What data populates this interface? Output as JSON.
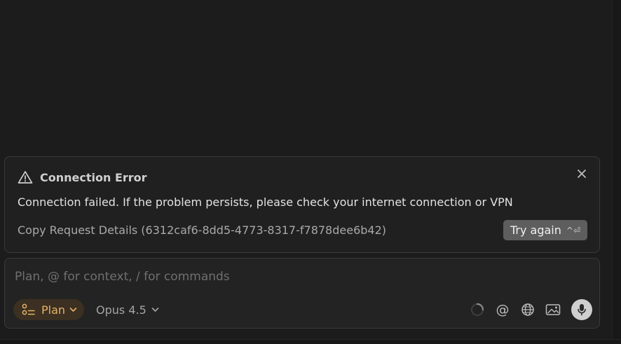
{
  "error": {
    "title": "Connection Error",
    "message": "Connection failed. If the problem persists, please check your internet connection or VPN",
    "copy_details": "Copy Request Details (6312caf6-8dd5-4773-8317-f7878dee6b42)",
    "try_again_label": "Try again",
    "try_again_shortcut": "^⏎",
    "icon": "warning-triangle-icon"
  },
  "composer": {
    "placeholder": "Plan, @ for context, / for commands",
    "value": "",
    "mode_label": "Plan",
    "model_label": "Opus 4.5",
    "at_symbol": "@",
    "icons": [
      "loading-spinner-icon",
      "mention-icon",
      "globe-icon",
      "image-icon",
      "microphone-icon"
    ]
  },
  "colors": {
    "background": "#1c1c1c",
    "card": "#202020",
    "border": "#3a3a3a",
    "mode_accent": "#e7b36a",
    "mode_bg": "#3b3021",
    "button": "#5e5e5e"
  }
}
